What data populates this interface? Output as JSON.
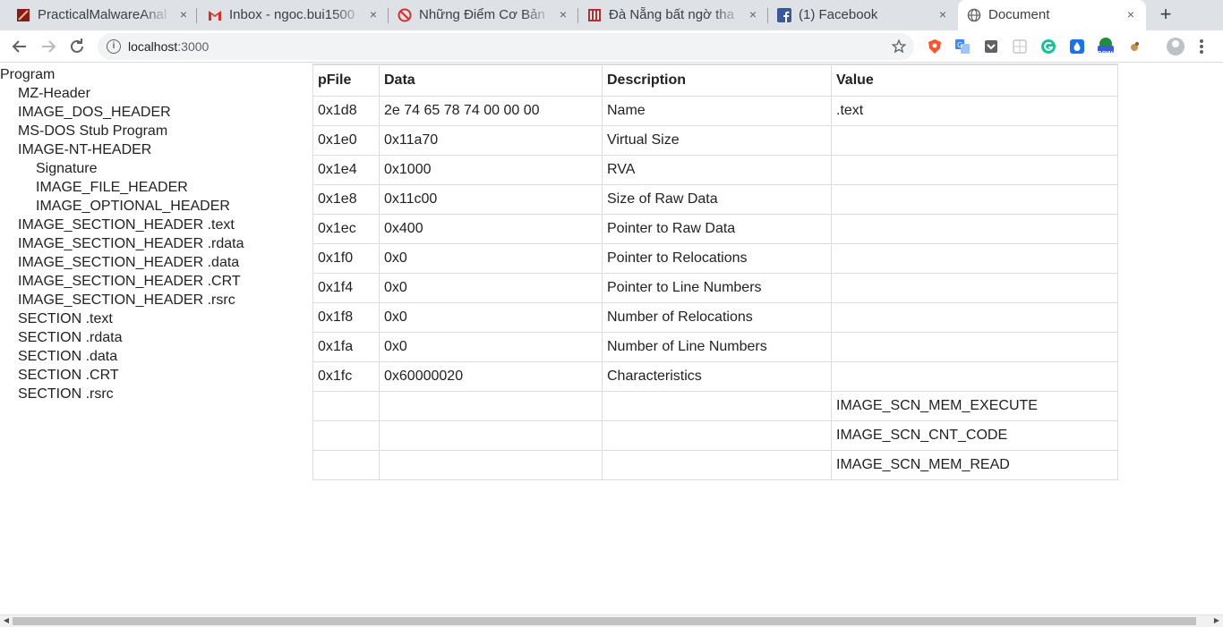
{
  "browser": {
    "tabs": [
      {
        "title": "PracticalMalwareAnal",
        "icon": "book-favicon-icon",
        "active": false
      },
      {
        "title": "Inbox - ngoc.bui1500",
        "icon": "gmail-favicon-icon",
        "active": false
      },
      {
        "title": "Những Điểm Cơ Bản",
        "icon": "red-circle-favicon-icon",
        "active": false
      },
      {
        "title": "Đà Nẵng bất ngờ tha",
        "icon": "news-favicon-icon",
        "active": false
      },
      {
        "title": "(1) Facebook",
        "icon": "facebook-favicon-icon",
        "active": false
      },
      {
        "title": "Document",
        "icon": "globe-favicon-icon",
        "active": true
      }
    ],
    "close_glyph": "×",
    "new_tab_glyph": "+",
    "address": {
      "host": "localhost",
      "port": ":3000"
    },
    "extensions_badge": "new"
  },
  "tree": [
    {
      "label": "Program",
      "level": 0
    },
    {
      "label": "MZ-Header",
      "level": 1
    },
    {
      "label": "IMAGE_DOS_HEADER",
      "level": 1
    },
    {
      "label": "MS-DOS Stub Program",
      "level": 1
    },
    {
      "label": "IMAGE-NT-HEADER",
      "level": 1
    },
    {
      "label": "Signature",
      "level": 2
    },
    {
      "label": "IMAGE_FILE_HEADER",
      "level": 2
    },
    {
      "label": "IMAGE_OPTIONAL_HEADER",
      "level": 2
    },
    {
      "label": "IMAGE_SECTION_HEADER .text",
      "level": 1
    },
    {
      "label": "IMAGE_SECTION_HEADER .rdata",
      "level": 1
    },
    {
      "label": "IMAGE_SECTION_HEADER .data",
      "level": 1
    },
    {
      "label": "IMAGE_SECTION_HEADER .CRT",
      "level": 1
    },
    {
      "label": "IMAGE_SECTION_HEADER .rsrc",
      "level": 1
    },
    {
      "label": "SECTION .text",
      "level": 1
    },
    {
      "label": "SECTION .rdata",
      "level": 1
    },
    {
      "label": "SECTION .data",
      "level": 1
    },
    {
      "label": "SECTION .CRT",
      "level": 1
    },
    {
      "label": "SECTION .rsrc",
      "level": 1
    }
  ],
  "table": {
    "headers": [
      "pFile",
      "Data",
      "Description",
      "Value"
    ],
    "rows": [
      [
        "0x1d8",
        "2e 74 65 78 74 00 00 00",
        "Name",
        ".text"
      ],
      [
        "0x1e0",
        "0x11a70",
        "Virtual Size",
        ""
      ],
      [
        "0x1e4",
        "0x1000",
        "RVA",
        ""
      ],
      [
        "0x1e8",
        "0x11c00",
        "Size of Raw Data",
        ""
      ],
      [
        "0x1ec",
        "0x400",
        "Pointer to Raw Data",
        ""
      ],
      [
        "0x1f0",
        "0x0",
        "Pointer to Relocations",
        ""
      ],
      [
        "0x1f4",
        "0x0",
        "Pointer to Line Numbers",
        ""
      ],
      [
        "0x1f8",
        "0x0",
        "Number of Relocations",
        ""
      ],
      [
        "0x1fa",
        "0x0",
        "Number of Line Numbers",
        ""
      ],
      [
        "0x1fc",
        "0x60000020",
        "Characteristics",
        ""
      ],
      [
        "",
        "",
        "",
        "IMAGE_SCN_MEM_EXECUTE"
      ],
      [
        "",
        "",
        "",
        "IMAGE_SCN_CNT_CODE"
      ],
      [
        "",
        "",
        "",
        "IMAGE_SCN_MEM_READ"
      ]
    ]
  },
  "colors": {
    "tabstrip": "#dee1e6",
    "border": "#dddddd",
    "text": "#222222",
    "facebook": "#3b5998",
    "gmail": "#d93025"
  }
}
